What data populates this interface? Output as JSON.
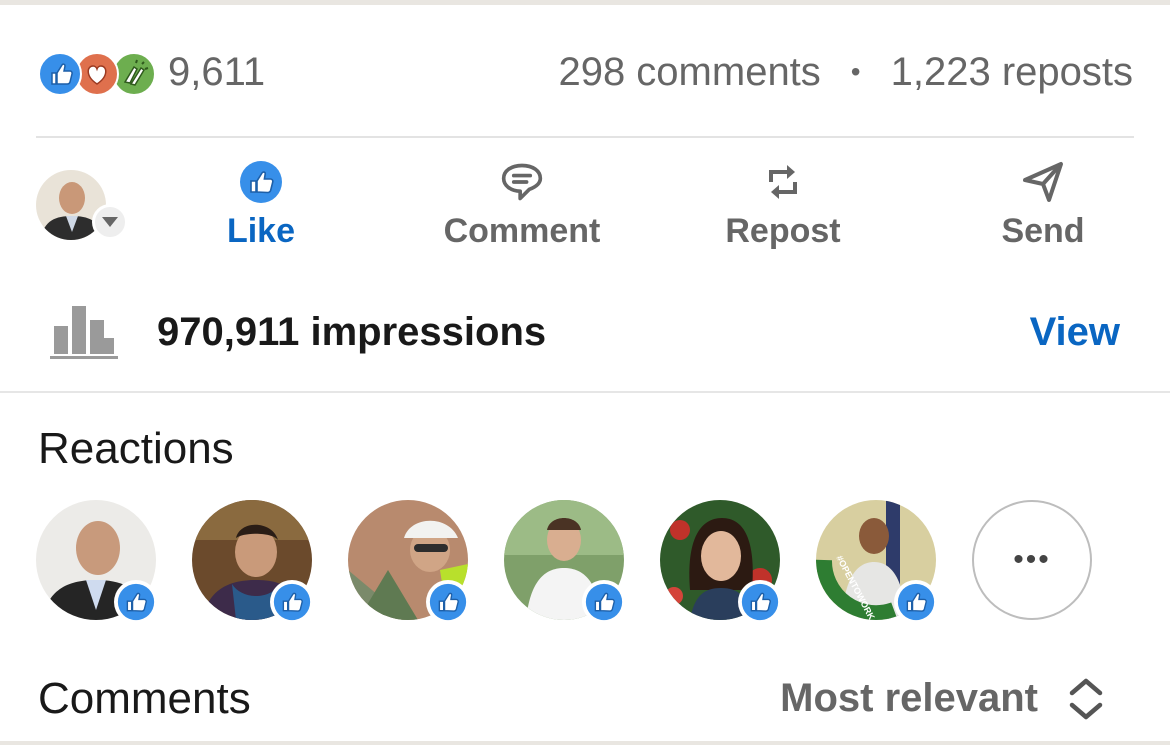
{
  "social_counts": {
    "reaction_icons": [
      "like-icon",
      "love-icon",
      "celebrate-icon"
    ],
    "reactions_count": "9,611",
    "comments": "298 comments",
    "separator": "•",
    "reposts": "1,223 reposts"
  },
  "actions": {
    "like": "Like",
    "comment": "Comment",
    "repost": "Repost",
    "send": "Send"
  },
  "impressions": {
    "text": "970,911 impressions",
    "view": "View"
  },
  "reactions": {
    "title": "Reactions",
    "reactors": [
      {
        "name": "reactor-1",
        "reaction": "like-icon"
      },
      {
        "name": "reactor-2",
        "reaction": "like-icon"
      },
      {
        "name": "reactor-3",
        "reaction": "like-icon"
      },
      {
        "name": "reactor-4",
        "reaction": "like-icon"
      },
      {
        "name": "reactor-5",
        "reaction": "like-icon"
      },
      {
        "name": "reactor-6",
        "reaction": "like-icon",
        "frame_text": "#OPENTOWORK"
      }
    ],
    "more_label": "•••"
  },
  "comments": {
    "title": "Comments",
    "sort_label": "Most relevant"
  },
  "colors": {
    "accent": "#0a66c2",
    "like": "#378fe9",
    "love": "#df704d",
    "celebrate": "#44712e",
    "muted_text": "#666666",
    "opentowork": "#2e7d32"
  }
}
